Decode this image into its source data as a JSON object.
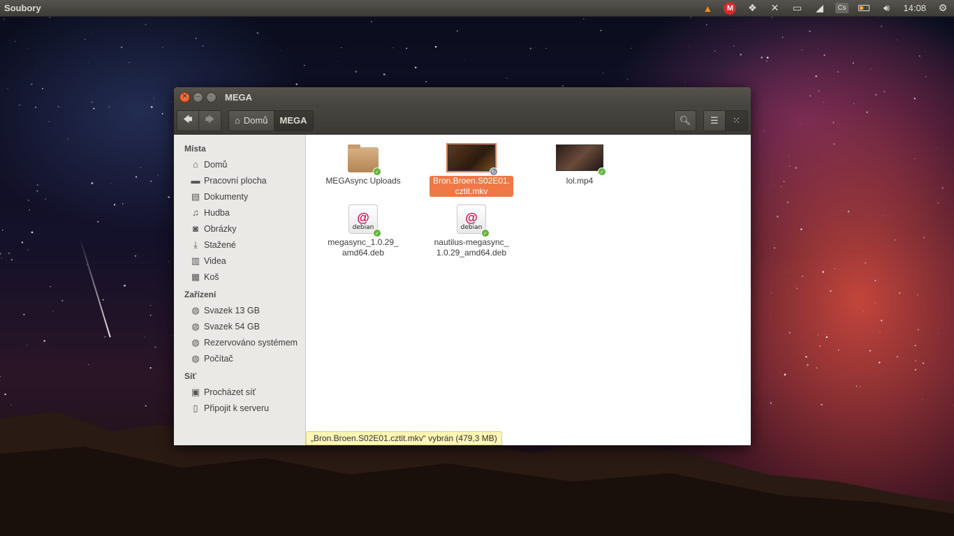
{
  "panel": {
    "app_title": "Soubory",
    "clock": "14:08",
    "tray_icons": [
      "vlc-icon",
      "mega-icon",
      "dropbox-icon",
      "crossover-icon",
      "clipboard-icon",
      "network-icon",
      "keyboard-icon",
      "battery-icon",
      "volume-icon",
      "settings-icon"
    ],
    "keyboard_label": "Cs"
  },
  "window": {
    "title": "MEGA",
    "breadcrumb": [
      {
        "label": "Domů",
        "icon": "home-icon"
      },
      {
        "label": "MEGA",
        "active": true
      }
    ]
  },
  "sidebar": {
    "sections": [
      {
        "title": "Místa",
        "items": [
          {
            "label": "Domů",
            "icon": "home-icon"
          },
          {
            "label": "Pracovní plocha",
            "icon": "desktop-icon"
          },
          {
            "label": "Dokumenty",
            "icon": "documents-icon"
          },
          {
            "label": "Hudba",
            "icon": "music-icon"
          },
          {
            "label": "Obrázky",
            "icon": "pictures-icon"
          },
          {
            "label": "Stažené",
            "icon": "download-icon"
          },
          {
            "label": "Videa",
            "icon": "video-icon"
          },
          {
            "label": "Koš",
            "icon": "trash-icon"
          }
        ]
      },
      {
        "title": "Zařízení",
        "items": [
          {
            "label": "Svazek 13 GB",
            "icon": "drive-icon"
          },
          {
            "label": "Svazek 54 GB",
            "icon": "drive-icon"
          },
          {
            "label": "Rezervováno systémem",
            "icon": "drive-icon"
          },
          {
            "label": "Počítač",
            "icon": "drive-icon"
          }
        ]
      },
      {
        "title": "Síť",
        "items": [
          {
            "label": "Procházet síť",
            "icon": "network-browse-icon"
          },
          {
            "label": "Připojit k serveru",
            "icon": "connect-server-icon"
          }
        ]
      }
    ]
  },
  "files": [
    {
      "name": "MEGAsync Uploads",
      "type": "folder",
      "badge": "synced"
    },
    {
      "name": "Bron.Broen.S02E01.cztit.mkv",
      "display_lines": [
        "Bron.Broen.S02E01.",
        "cztit.mkv"
      ],
      "type": "video",
      "selected": true,
      "badge": "syncing"
    },
    {
      "name": "lol.mp4",
      "display_lines": [
        "lol.mp4"
      ],
      "type": "video-dark",
      "badge": "synced"
    },
    {
      "name": "megasync_1.0.29_amd64.deb",
      "display_lines": [
        "megasync_1.0.29_",
        "amd64.deb"
      ],
      "type": "deb",
      "badge": "synced"
    },
    {
      "name": "nautilus-megasync_1.0.29_amd64.deb",
      "display_lines": [
        "nautilus-megasync_",
        "1.0.29_amd64.deb"
      ],
      "type": "deb",
      "badge": "synced"
    }
  ],
  "deb_label": "debian",
  "status": "„Bron.Broen.S02E01.cztit.mkv“ vybrán  (479,3 MB)"
}
